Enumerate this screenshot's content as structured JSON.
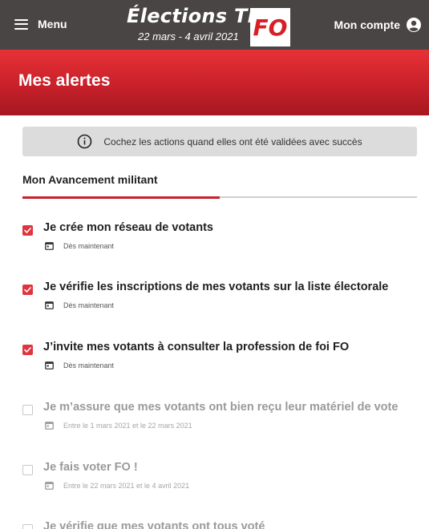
{
  "header": {
    "menu_label": "Menu",
    "brand_title": "Élections TPE",
    "brand_subtitle": "22 mars - 4 avril 2021",
    "logo_text": "FO",
    "account_label": "Mon compte"
  },
  "banner": {
    "title": "Mes alertes"
  },
  "notice": {
    "text": "Cochez les actions quand elles ont été validées avec succès"
  },
  "progress": {
    "title": "Mon Avancement militant",
    "fraction": 0.5
  },
  "actions": [
    {
      "title": "Je crée mon réseau de votants",
      "date": "Dès maintenant",
      "checked": true
    },
    {
      "title": "Je vérifie les inscriptions de mes votants sur la liste électorale",
      "date": "Dès maintenant",
      "checked": true
    },
    {
      "title": "J’invite mes votants à consulter la profession de foi FO",
      "date": "Dès maintenant",
      "checked": true
    },
    {
      "title": "Je m’assure que mes votants ont bien reçu leur matériel de vote",
      "date": "Entre le 1 mars 2021 et le 22 mars 2021",
      "checked": false
    },
    {
      "title": "Je fais voter FO !",
      "date": "Entre le 22 mars 2021 et le 4 avril 2021",
      "checked": false
    },
    {
      "title": "Je vérifie que mes votants ont tous voté",
      "date": "",
      "checked": false
    }
  ],
  "colors": {
    "accent": "#d61f26",
    "header_bg": "#4a4545",
    "checkbox_checked": "#e0353f"
  },
  "icons": {
    "menu": "hamburger-icon",
    "account": "user-circle-icon",
    "info": "info-icon",
    "date": "calendar-icon",
    "check": "check-icon"
  }
}
